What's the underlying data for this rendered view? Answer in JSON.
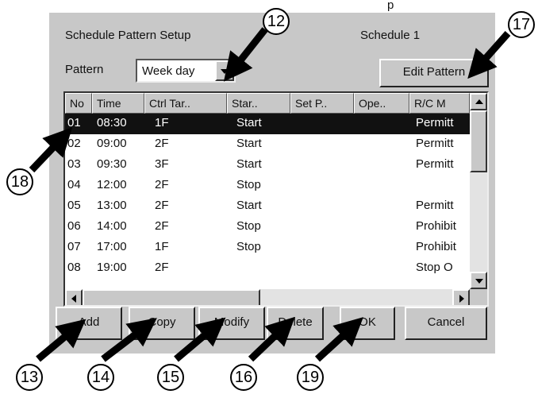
{
  "caption_top": "p",
  "window": {
    "title": "Schedule Pattern Setup",
    "schedule_name": "Schedule 1",
    "pattern_label": "Pattern",
    "pattern_value": "Week day",
    "edit_pattern_label": "Edit Pattern"
  },
  "table": {
    "columns": [
      "No",
      "Time",
      "Ctrl Tar..",
      "Star..",
      "Set P..",
      "Ope..",
      "R/C M"
    ],
    "rows": [
      {
        "no": "01",
        "time": "08:30",
        "target": "1F",
        "startstop": "Start",
        "setp": "",
        "ope": "",
        "rc": "Permitt"
      },
      {
        "no": "02",
        "time": "09:00",
        "target": "2F",
        "startstop": "Start",
        "setp": "",
        "ope": "",
        "rc": "Permitt"
      },
      {
        "no": "03",
        "time": "09:30",
        "target": "3F",
        "startstop": "Start",
        "setp": "",
        "ope": "",
        "rc": "Permitt"
      },
      {
        "no": "04",
        "time": "12:00",
        "target": "2F",
        "startstop": "Stop",
        "setp": "",
        "ope": "",
        "rc": ""
      },
      {
        "no": "05",
        "time": "13:00",
        "target": "2F",
        "startstop": "Start",
        "setp": "",
        "ope": "",
        "rc": "Permitt"
      },
      {
        "no": "06",
        "time": "14:00",
        "target": "2F",
        "startstop": "Stop",
        "setp": "",
        "ope": "",
        "rc": "Prohibit"
      },
      {
        "no": "07",
        "time": "17:00",
        "target": "1F",
        "startstop": "Stop",
        "setp": "",
        "ope": "",
        "rc": "Prohibit"
      },
      {
        "no": "08",
        "time": "19:00",
        "target": "2F",
        "startstop": "",
        "setp": "",
        "ope": "",
        "rc": "Stop O"
      }
    ],
    "selected_index": 0
  },
  "buttons": {
    "add": "Add",
    "copy": "Copy",
    "modify": "Modify",
    "delete": "Delete",
    "ok": "OK",
    "cancel": "Cancel"
  },
  "callouts": {
    "c12": "12",
    "c13": "13",
    "c14": "14",
    "c15": "15",
    "c16": "16",
    "c17": "17",
    "c18": "18",
    "c19": "19"
  },
  "colors": {
    "window_bg": "#c8c8c8",
    "selection_bg": "#111111",
    "arrow": "#000000"
  },
  "icons": {
    "combo_arrow": "chevron-down-icon",
    "scroll_up": "scroll-up-icon",
    "scroll_down": "scroll-down-icon",
    "scroll_left": "scroll-left-icon",
    "scroll_right": "scroll-right-icon"
  }
}
